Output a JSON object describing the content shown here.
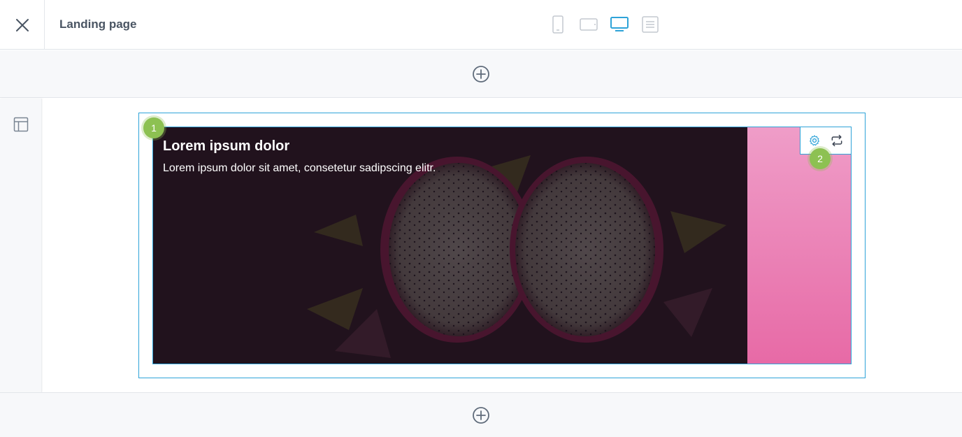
{
  "header": {
    "title": "Landing page",
    "close_icon": "close-icon",
    "devices": [
      {
        "name": "mobile",
        "icon": "mobile-device-icon",
        "active": false
      },
      {
        "name": "tablet",
        "icon": "tablet-device-icon",
        "active": false
      },
      {
        "name": "desktop",
        "icon": "desktop-device-icon",
        "active": true
      },
      {
        "name": "text",
        "icon": "text-view-icon",
        "active": false
      }
    ]
  },
  "colors": {
    "accent": "#2ea3d8",
    "badge": "#8dc152",
    "hero_background": "#23151f",
    "pink_panel": "#e76aa6"
  },
  "sidebar": {
    "layout_icon": "layout-icon"
  },
  "block": {
    "heading": "Lorem ipsum dolor",
    "text": "Lorem ipsum dolor sit amet, consetetur sadipscing elitr."
  },
  "toolbar": {
    "settings_icon": "gear-icon",
    "swap_icon": "repeat-icon"
  },
  "badges": {
    "one": "1",
    "two": "2"
  }
}
